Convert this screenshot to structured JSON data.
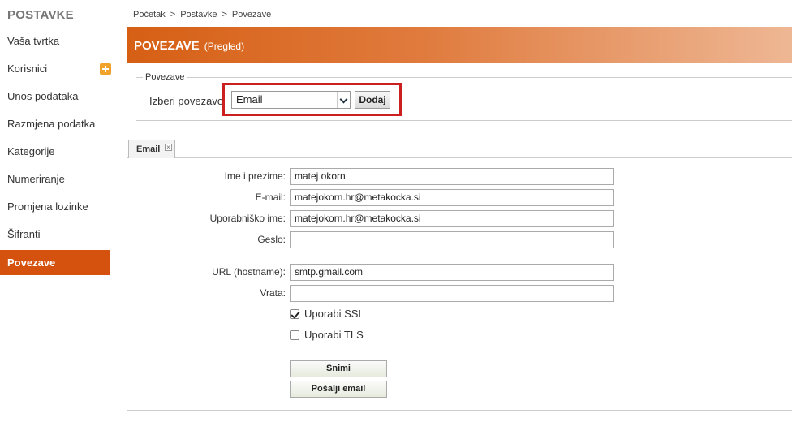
{
  "sidebar": {
    "title": "POSTAVKE",
    "items": [
      {
        "label": "Vaša tvrtka"
      },
      {
        "label": "Korisnici"
      },
      {
        "label": "Unos podataka"
      },
      {
        "label": "Razmjena podatka"
      },
      {
        "label": "Kategorije"
      },
      {
        "label": "Numeriranje"
      },
      {
        "label": "Promjena lozinke"
      },
      {
        "label": "Šifranti"
      },
      {
        "label": "Povezave",
        "active": true
      }
    ]
  },
  "breadcrumb": {
    "items": [
      "Početak",
      "Postavke",
      "Povezave"
    ],
    "separator": ">"
  },
  "header": {
    "title": "POVEZAVE",
    "subtitle": "(Pregled)"
  },
  "connections": {
    "legend": "Povezave",
    "select_label": "Izberi povezavo",
    "select_value": "Email",
    "add_label": "Dodaj"
  },
  "tab": {
    "label": "Email",
    "close": "×"
  },
  "form": {
    "name_label": "Ime i prezime:",
    "name_value": "matej okorn",
    "email_label": "E-mail:",
    "email_value": "matejokorn.hr@metakocka.si",
    "username_label": "Uporabniško ime:",
    "username_value": "matejokorn.hr@metakocka.si",
    "password_label": "Geslo:",
    "password_value": "",
    "url_label": "URL (hostname):",
    "url_value": "smtp.gmail.com",
    "port_label": "Vrata:",
    "port_value": "",
    "ssl_label": "Uporabi SSL",
    "ssl_checked": true,
    "tls_label": "Uporabi TLS",
    "tls_checked": false,
    "save_label": "Snimi",
    "send_label": "Pošalji email"
  },
  "colors": {
    "accent": "#d4520e",
    "highlight": "#cc1f1f"
  }
}
